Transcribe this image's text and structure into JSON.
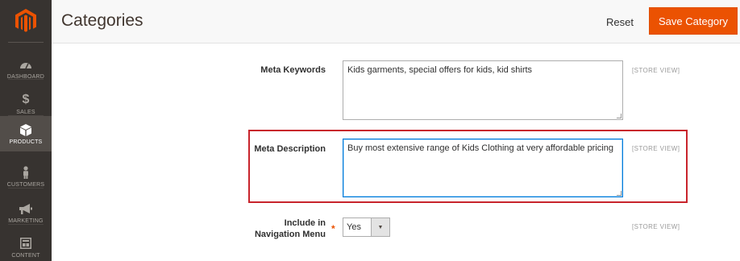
{
  "sidebar": {
    "items": [
      {
        "label": "DASHBOARD",
        "icon": "dashboard-icon"
      },
      {
        "label": "SALES",
        "icon": "dollar-icon"
      },
      {
        "label": "PRODUCTS",
        "icon": "cube-icon",
        "active": true
      },
      {
        "label": "CUSTOMERS",
        "icon": "person-icon"
      },
      {
        "label": "MARKETING",
        "icon": "megaphone-icon"
      },
      {
        "label": "CONTENT",
        "icon": "layout-icon"
      }
    ]
  },
  "header": {
    "title": "Categories",
    "reset_label": "Reset",
    "save_label": "Save Category"
  },
  "form": {
    "meta_keywords": {
      "label": "Meta Keywords",
      "value": "Kids garments, special offers for kids, kid shirts",
      "scope": "[STORE VIEW]"
    },
    "meta_description": {
      "label": "Meta Description",
      "value": "Buy most extensive range of Kids Clothing at very affordable pricing",
      "scope": "[STORE VIEW]"
    },
    "include_in_menu": {
      "label_line1": "Include in",
      "label_line2": "Navigation Menu",
      "required_mark": "*",
      "value": "Yes",
      "scope": "[STORE VIEW]"
    }
  },
  "colors": {
    "sidebar_bg": "#373330",
    "accent": "#eb5202",
    "highlight": "#c8242c"
  }
}
